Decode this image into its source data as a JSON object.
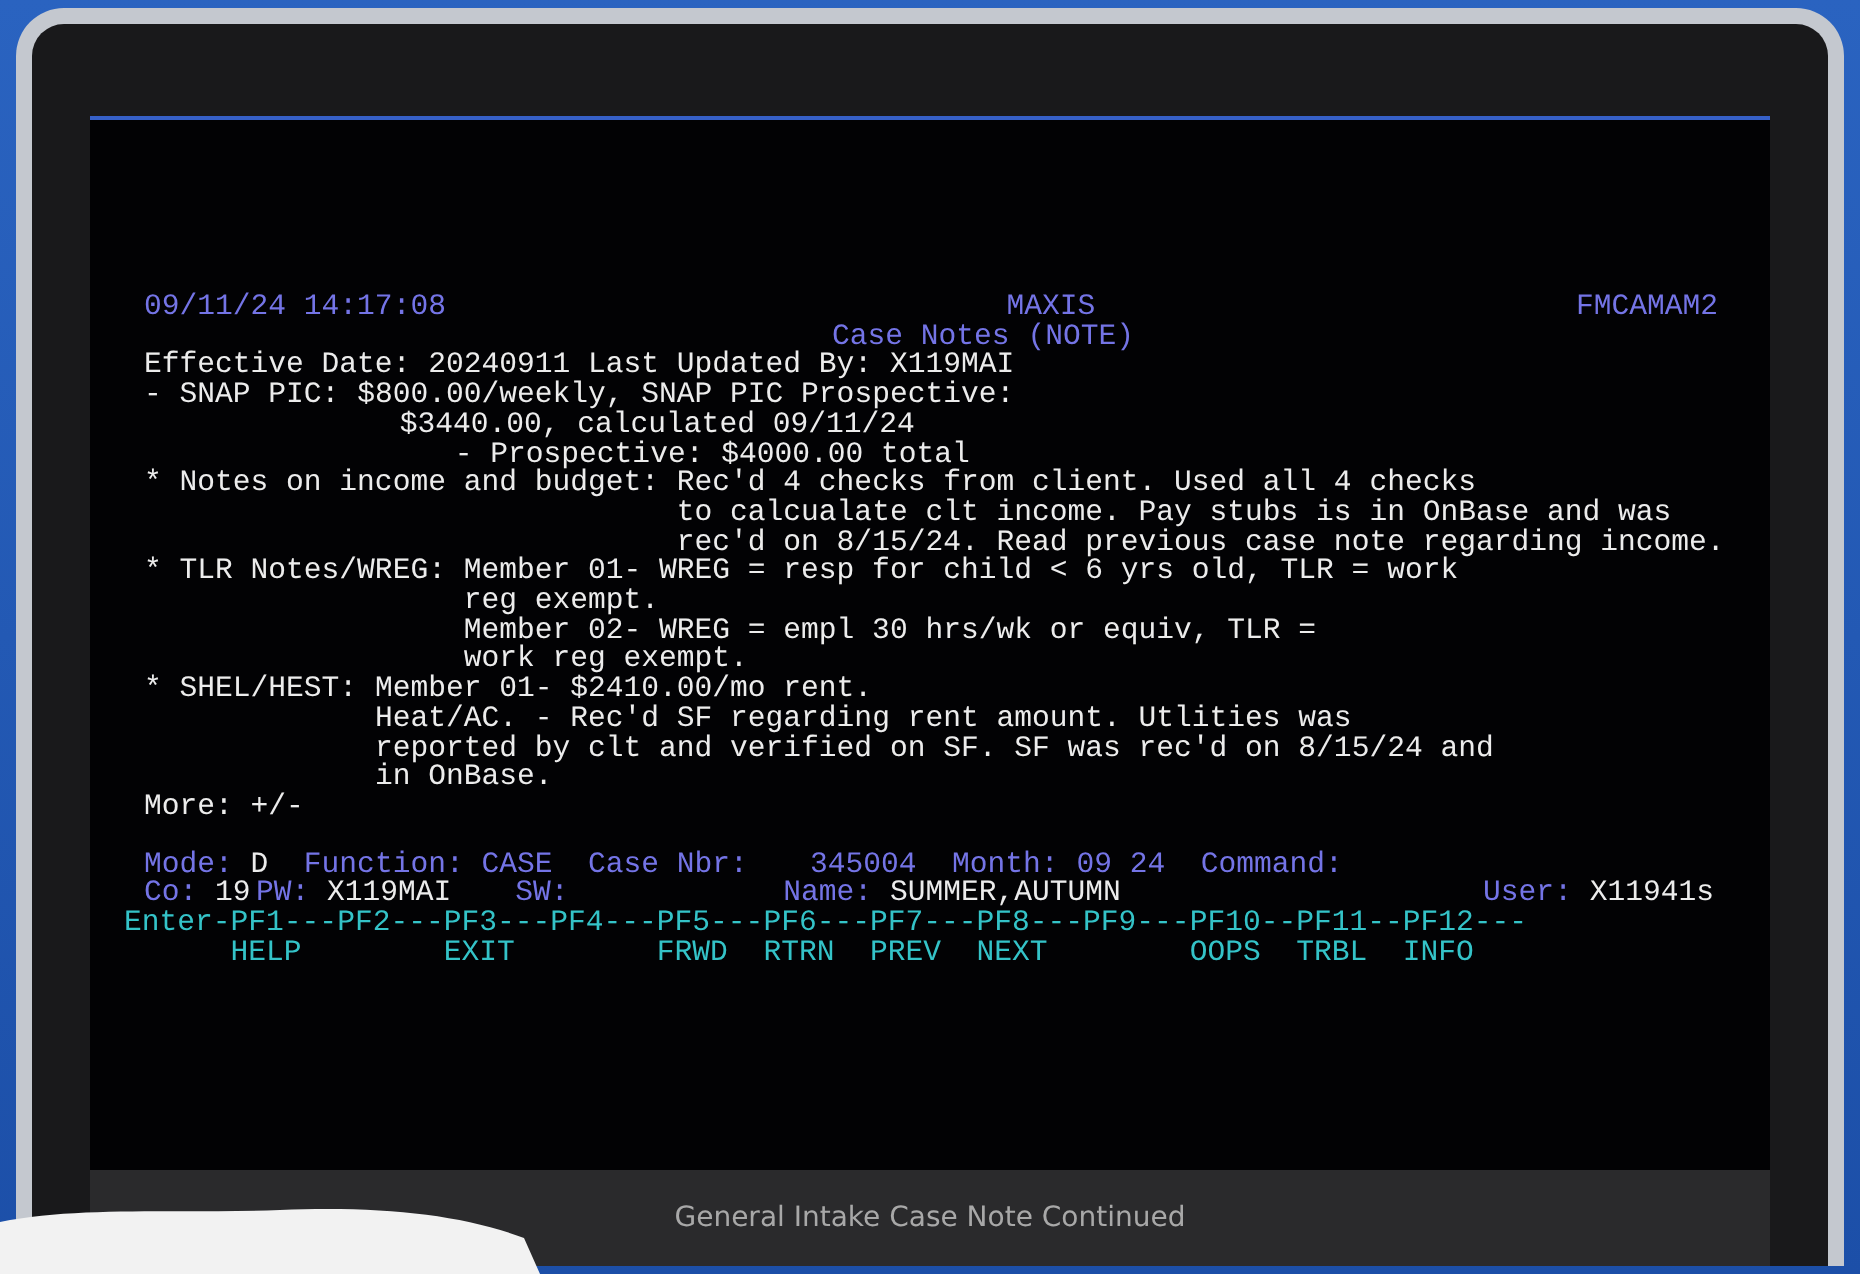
{
  "terminal": {
    "header": {
      "timestamp": "09/11/24 14:17:08",
      "system": "MAXIS",
      "screen_id": "FMCAMAM2",
      "title": "Case Notes (NOTE)"
    },
    "effective_line": "Effective Date: 20240911 Last Updated By: X119MAI",
    "notes": [
      {
        "label": "- SNAP PIC:",
        "lines": [
          "$800.00/weekly, SNAP PIC Prospective:",
          "$3440.00, calculated 09/11/24",
          "- Prospective: $4000.00 total"
        ]
      },
      {
        "label": "* Notes on income and budget:",
        "lines": [
          "Rec'd 4 checks from client. Used all 4 checks",
          "to calcualate clt income. Pay stubs is in OnBase and was",
          "rec'd on 8/15/24. Read previous case note regarding income."
        ]
      },
      {
        "label": "* TLR Notes/WREG:",
        "lines": [
          "Member 01- WREG = resp for child < 6 yrs old, TLR = work",
          "reg exempt.",
          "Member 02- WREG = empl 30 hrs/wk or equiv, TLR =",
          "work reg exempt."
        ]
      },
      {
        "label": "* SHEL/HEST:",
        "lines": [
          "Member 01- $2410.00/mo rent.",
          "Heat/AC. - Rec'd SF regarding rent amount. Utlities was",
          "reported by clt and verified on SF. SF was rec'd on 8/15/24 and",
          "in OnBase."
        ]
      }
    ],
    "more": "More: +/-",
    "status_line_1": [
      {
        "label": "Mode:",
        "value": "D",
        "kind": "plain"
      },
      {
        "label": "Function:",
        "value": "CASE",
        "kind": "field"
      },
      {
        "label": "Case Nbr:",
        "value": "345004",
        "kind": "field"
      },
      {
        "label": "Month:",
        "value": "09 24",
        "kind": "field"
      },
      {
        "label": "Command:"
      }
    ],
    "status_line_2": [
      {
        "label": "Co:",
        "value": "19"
      },
      {
        "label": "PW:",
        "value": "X119MAI"
      },
      {
        "label": "SW:"
      },
      {
        "label": "Name:",
        "value": "SUMMER,AUTUMN"
      },
      {
        "label": "User:",
        "value": "X11941s"
      }
    ],
    "function_keys": [
      {
        "key": "Enter-"
      },
      {
        "key": "PF1---",
        "action": "HELP"
      },
      {
        "key": "PF2---"
      },
      {
        "key": "PF3---",
        "action": "EXIT"
      },
      {
        "key": "PF4---"
      },
      {
        "key": "PF5---",
        "action": "FRWD"
      },
      {
        "key": "PF6---",
        "action": "RTRN"
      },
      {
        "key": "PF7---",
        "action": "PREV"
      },
      {
        "key": "PF8---",
        "action": "NEXT"
      },
      {
        "key": "PF9---"
      },
      {
        "key": "PF10--",
        "action": "OOPS"
      },
      {
        "key": "PF11--",
        "action": "TRBL"
      },
      {
        "key": "PF12---",
        "action": "INFO"
      }
    ]
  },
  "caption": "General Intake Case Note Continued"
}
